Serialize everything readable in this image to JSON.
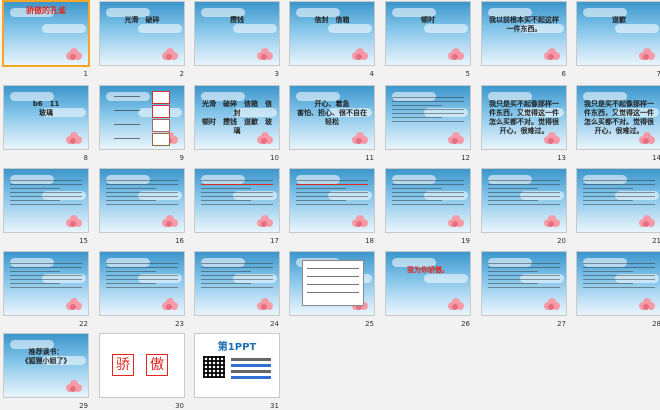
{
  "slides": [
    {
      "n": "1",
      "title": "",
      "body": "",
      "style": "cover",
      "cover_title": "骄傲的孔雀"
    },
    {
      "n": "2",
      "title": "",
      "body": "光滑　破碎",
      "style": "text"
    },
    {
      "n": "3",
      "title": "",
      "body": "攒钱",
      "style": "text"
    },
    {
      "n": "4",
      "title": "",
      "body": "信封　信箱",
      "style": "text"
    },
    {
      "n": "5",
      "title": "",
      "body": "顿时",
      "style": "text"
    },
    {
      "n": "6",
      "title": "",
      "body": "我以前根本买不起这样一件东西。",
      "style": "text"
    },
    {
      "n": "7",
      "title": "",
      "body": "道歉",
      "style": "text"
    },
    {
      "n": "8",
      "title": "",
      "body": "b6　11\n玻璃",
      "style": "text"
    },
    {
      "n": "9",
      "title": "",
      "body": "",
      "style": "vocab"
    },
    {
      "n": "10",
      "title": "",
      "body": "光滑　破碎　信箱　信封\n顿时　攒钱　道歉　玻璃",
      "style": "text"
    },
    {
      "n": "11",
      "title": "",
      "body": "开心、着急\n害怕、担心、很不自在\n轻松",
      "style": "text"
    },
    {
      "n": "12",
      "title": "",
      "body": "",
      "style": "lines"
    },
    {
      "n": "13",
      "title": "",
      "body": "我只是买不起像那样一件东西，又觉得这一件怎么买都不对。觉得很开心，很难过。",
      "style": "text"
    },
    {
      "n": "14",
      "title": "",
      "body": "我只是买不起像那样一件东西，又觉得这一件怎么买都不对。觉得很开心，很难过。",
      "style": "text"
    },
    {
      "n": "15",
      "title": "",
      "body": "",
      "style": "lines"
    },
    {
      "n": "16",
      "title": "",
      "body": "",
      "style": "lines"
    },
    {
      "n": "17",
      "title": "",
      "body": "",
      "style": "lines"
    },
    {
      "n": "18",
      "title": "",
      "body": "",
      "style": "lines"
    },
    {
      "n": "19",
      "title": "",
      "body": "",
      "style": "lines"
    },
    {
      "n": "20",
      "title": "",
      "body": "",
      "style": "lines"
    },
    {
      "n": "21",
      "title": "",
      "body": "",
      "style": "lines"
    },
    {
      "n": "22",
      "title": "",
      "body": "",
      "style": "lines"
    },
    {
      "n": "23",
      "title": "",
      "body": "",
      "style": "lines"
    },
    {
      "n": "24",
      "title": "",
      "body": "",
      "style": "lines"
    },
    {
      "n": "25",
      "title": "",
      "body": "",
      "style": "card"
    },
    {
      "n": "26",
      "title": "",
      "body": "我为你骄傲。",
      "style": "redtext"
    },
    {
      "n": "27",
      "title": "",
      "body": "",
      "style": "lines"
    },
    {
      "n": "28",
      "title": "",
      "body": "",
      "style": "lines"
    },
    {
      "n": "29",
      "title": "",
      "body": "推荐读书：\n《狐狸小姐了》",
      "style": "text"
    },
    {
      "n": "30",
      "title": "",
      "body": "",
      "style": "chars",
      "chars": [
        "骄",
        "傲"
      ]
    },
    {
      "n": "31",
      "title": "",
      "body": "",
      "style": "ppt",
      "logo": "第1PPT"
    }
  ]
}
